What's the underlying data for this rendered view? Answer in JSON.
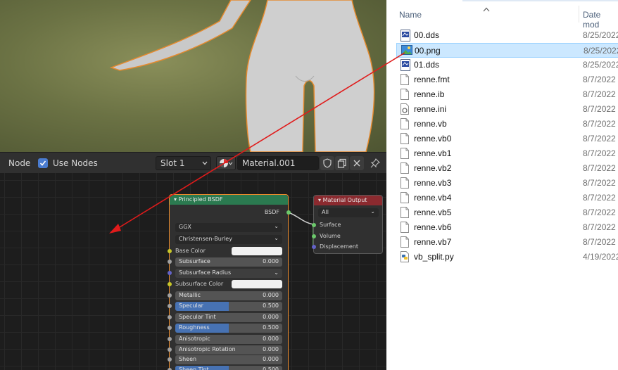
{
  "node_header": {
    "menu_node": "Node",
    "use_nodes_label": "Use Nodes",
    "slot": "Slot 1",
    "material_name": "Material.001"
  },
  "principled_node": {
    "title": "Principled BSDF",
    "output_label": "BSDF",
    "distribution": "GGX",
    "subsurface_method": "Christensen-Burley",
    "rows": [
      {
        "label": "Base Color",
        "type": "color",
        "socket": "#c7c729"
      },
      {
        "label": "Subsurface",
        "type": "value",
        "value": "0.000",
        "fill": 0,
        "socket": "#a1a1a1"
      },
      {
        "label": "Subsurface Radius",
        "type": "select",
        "socket": "#6363c7"
      },
      {
        "label": "Subsurface Color",
        "type": "color",
        "socket": "#c7c729"
      },
      {
        "label": "Metallic",
        "type": "value",
        "value": "0.000",
        "fill": 0,
        "socket": "#a1a1a1"
      },
      {
        "label": "Specular",
        "type": "value",
        "value": "0.500",
        "fill": 0.5,
        "socket": "#a1a1a1"
      },
      {
        "label": "Specular Tint",
        "type": "value",
        "value": "0.000",
        "fill": 0,
        "socket": "#a1a1a1"
      },
      {
        "label": "Roughness",
        "type": "value",
        "value": "0.500",
        "fill": 0.5,
        "socket": "#a1a1a1"
      },
      {
        "label": "Anisotropic",
        "type": "value",
        "value": "0.000",
        "fill": 0,
        "socket": "#a1a1a1"
      },
      {
        "label": "Anisotropic Rotation",
        "type": "value",
        "value": "0.000",
        "fill": 0,
        "socket": "#a1a1a1"
      },
      {
        "label": "Sheen",
        "type": "value",
        "value": "0.000",
        "fill": 0,
        "socket": "#a1a1a1"
      },
      {
        "label": "Sheen Tint",
        "type": "value",
        "value": "0.500",
        "fill": 0.5,
        "socket": "#a1a1a1"
      }
    ]
  },
  "output_node": {
    "title": "Material Output",
    "target": "All",
    "inputs": [
      "Surface",
      "Volume",
      "Displacement"
    ]
  },
  "explorer": {
    "columns": {
      "name": "Name",
      "date": "Date mod"
    },
    "files": [
      {
        "name": "00.dds",
        "date": "8/25/2022",
        "icon": "dds-image-icon"
      },
      {
        "name": "00.png",
        "date": "8/25/2022",
        "icon": "png-image-icon",
        "selected": true
      },
      {
        "name": "01.dds",
        "date": "8/25/2022",
        "icon": "dds-image-icon"
      },
      {
        "name": "renne.fmt",
        "date": "8/7/2022",
        "icon": "file-icon"
      },
      {
        "name": "renne.ib",
        "date": "8/7/2022",
        "icon": "file-icon"
      },
      {
        "name": "renne.ini",
        "date": "8/7/2022",
        "icon": "settings-file-icon"
      },
      {
        "name": "renne.vb",
        "date": "8/7/2022",
        "icon": "file-icon"
      },
      {
        "name": "renne.vb0",
        "date": "8/7/2022",
        "icon": "file-icon"
      },
      {
        "name": "renne.vb1",
        "date": "8/7/2022",
        "icon": "file-icon"
      },
      {
        "name": "renne.vb2",
        "date": "8/7/2022",
        "icon": "file-icon"
      },
      {
        "name": "renne.vb3",
        "date": "8/7/2022",
        "icon": "file-icon"
      },
      {
        "name": "renne.vb4",
        "date": "8/7/2022",
        "icon": "file-icon"
      },
      {
        "name": "renne.vb5",
        "date": "8/7/2022",
        "icon": "file-icon"
      },
      {
        "name": "renne.vb6",
        "date": "8/7/2022",
        "icon": "file-icon"
      },
      {
        "name": "renne.vb7",
        "date": "8/7/2022",
        "icon": "file-icon"
      },
      {
        "name": "vb_split.py",
        "date": "4/19/2022",
        "icon": "python-file-icon"
      }
    ]
  },
  "colors": {
    "principled_header": "#2b7a50",
    "output_header": "#8b2a2f",
    "selection_outline": "#e68a2e",
    "drag_arrow": "#e01b1b",
    "explorer_selection": "#cce8ff"
  }
}
